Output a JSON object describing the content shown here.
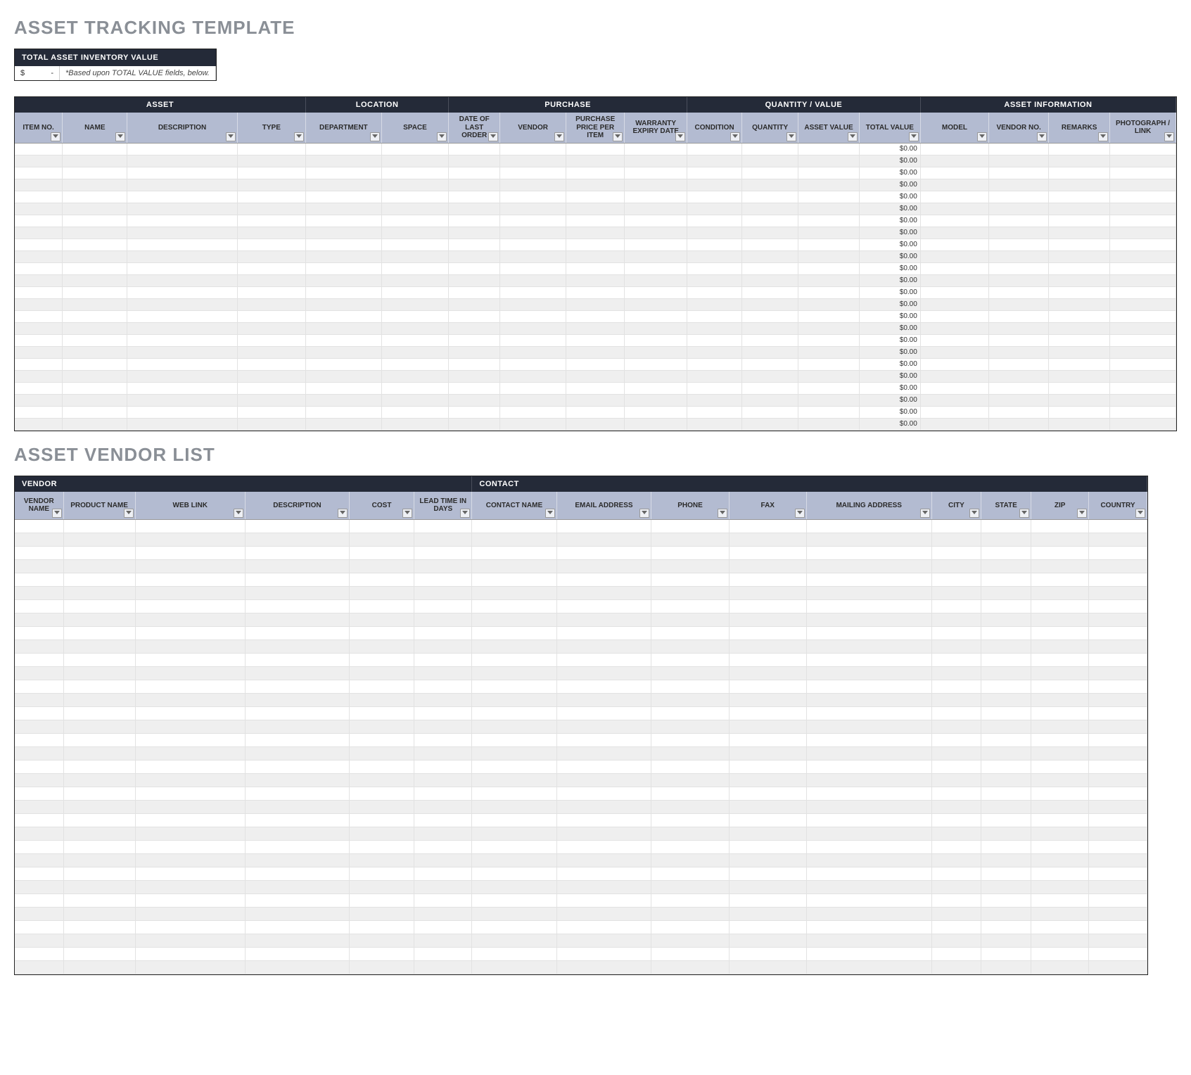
{
  "title1": "ASSET TRACKING TEMPLATE",
  "summary": {
    "header": "TOTAL ASSET INVENTORY VALUE",
    "currency": "$",
    "value": "-",
    "note": "*Based upon TOTAL VALUE fields, below."
  },
  "asset_table": {
    "groups": [
      {
        "label": "ASSET",
        "span": 4
      },
      {
        "label": "LOCATION",
        "span": 2
      },
      {
        "label": "PURCHASE",
        "span": 4
      },
      {
        "label": "QUANTITY / VALUE",
        "span": 4
      },
      {
        "label": "ASSET INFORMATION",
        "span": 4
      }
    ],
    "columns": [
      "ITEM NO.",
      "NAME",
      "DESCRIPTION",
      "TYPE",
      "DEPARTMENT",
      "SPACE",
      "DATE OF LAST ORDER",
      "VENDOR",
      "PURCHASE PRICE PER ITEM",
      "WARRANTY EXPIRY DATE",
      "CONDITION",
      "QUANTITY",
      "ASSET VALUE",
      "TOTAL VALUE",
      "MODEL",
      "VENDOR NO.",
      "REMARKS",
      "PHOTOGRAPH / LINK"
    ],
    "total_value_cell": "$0.00",
    "row_count": 24
  },
  "title2": "ASSET VENDOR LIST",
  "vendor_table": {
    "groups": [
      {
        "label": "VENDOR",
        "span": 6
      },
      {
        "label": "CONTACT",
        "span": 9
      }
    ],
    "columns": [
      "VENDOR NAME",
      "PRODUCT NAME",
      "WEB LINK",
      "DESCRIPTION",
      "COST",
      "LEAD TIME IN DAYS",
      "CONTACT NAME",
      "EMAIL ADDRESS",
      "PHONE",
      "FAX",
      "MAILING ADDRESS",
      "CITY",
      "STATE",
      "ZIP",
      "COUNTRY"
    ],
    "row_count": 34
  }
}
